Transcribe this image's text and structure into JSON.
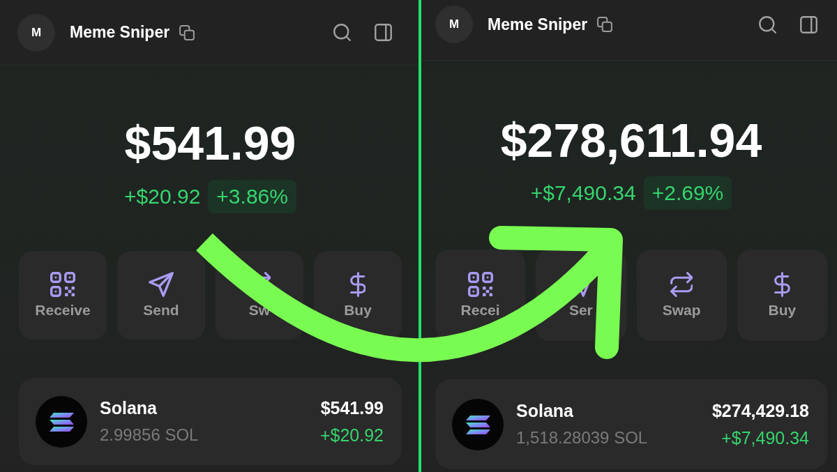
{
  "panels": [
    {
      "header": {
        "avatar": "M",
        "title": "Meme Sniper"
      },
      "balance": {
        "total": "$541.99",
        "change": "+$20.92",
        "change_percent": "+3.86%"
      },
      "actions": [
        {
          "kind": "receive",
          "label": "Receive"
        },
        {
          "kind": "send",
          "label": "Send"
        },
        {
          "kind": "swap",
          "label": "Sw"
        },
        {
          "kind": "buy",
          "label": "Buy"
        }
      ],
      "tokens": [
        {
          "name": "Solana",
          "amount": "2.99856 SOL",
          "value": "$541.99",
          "change": "+$20.92"
        }
      ]
    },
    {
      "header": {
        "avatar": "M",
        "title": "Meme Sniper"
      },
      "balance": {
        "total": "$278,611.94",
        "change": "+$7,490.34",
        "change_percent": "+2.69%"
      },
      "actions": [
        {
          "kind": "receive",
          "label": "Recei"
        },
        {
          "kind": "send",
          "label": "Ser"
        },
        {
          "kind": "swap",
          "label": "Swap"
        },
        {
          "kind": "buy",
          "label": "Buy"
        }
      ],
      "tokens": [
        {
          "name": "Solana",
          "amount": "1,518.28039 SOL",
          "value": "$274,429.18",
          "change": "+$7,490.34"
        }
      ]
    }
  ]
}
